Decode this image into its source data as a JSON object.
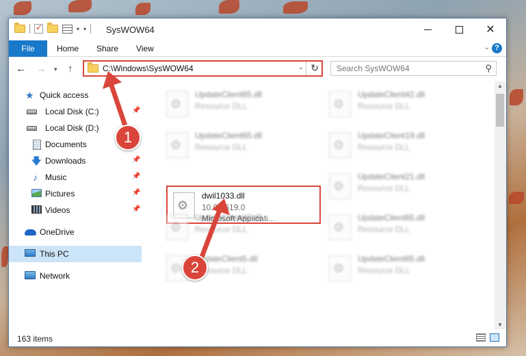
{
  "window": {
    "title": "SysWOW64",
    "controls": {
      "minimize": "—",
      "maximize": "□",
      "close": "✕"
    }
  },
  "ribbon": {
    "tabs": [
      "File",
      "Home",
      "Share",
      "View"
    ],
    "help": "?"
  },
  "navigation": {
    "back": "←",
    "forward": "→",
    "recent": "▾",
    "up": "↑",
    "address": "C:\\Windows\\SysWOW64",
    "refresh": "↻",
    "search_placeholder": "Search SysWOW64"
  },
  "sidebar": {
    "items": [
      {
        "label": "Quick access",
        "icon": "star-icon",
        "pinned": false
      },
      {
        "label": "Local Disk (C:)",
        "icon": "disk-icon",
        "pinned": true
      },
      {
        "label": "Local Disk (D:)",
        "icon": "disk-icon",
        "pinned": false
      },
      {
        "label": "Documents",
        "icon": "document-icon",
        "pinned": true
      },
      {
        "label": "Downloads",
        "icon": "download-icon",
        "pinned": true
      },
      {
        "label": "Music",
        "icon": "music-icon",
        "pinned": true
      },
      {
        "label": "Pictures",
        "icon": "picture-icon",
        "pinned": true
      },
      {
        "label": "Videos",
        "icon": "video-icon",
        "pinned": true
      },
      {
        "label": "OneDrive",
        "icon": "onedrive-icon",
        "pinned": false
      },
      {
        "label": "This PC",
        "icon": "pc-icon",
        "pinned": false,
        "selected": true
      },
      {
        "label": "Network",
        "icon": "network-icon",
        "pinned": false
      }
    ],
    "pin_glyph": "📌"
  },
  "files": [
    {
      "name": "UpdateClient65.dll",
      "line2": "Resource DLL",
      "line3": "",
      "blurred": true
    },
    {
      "name": "UpdateClient42.dll",
      "line2": "Resource DLL",
      "line3": "",
      "blurred": true
    },
    {
      "name": "UpdateClient65.dll",
      "line2": "Resource DLL",
      "line3": "",
      "blurred": true
    },
    {
      "name": "UpdateClient19.dll",
      "line2": "Resource DLL",
      "line3": "",
      "blurred": true
    },
    {
      "name": "dwil1033.dll",
      "line2": "10.0.2619.0",
      "line3": "Microsoft Applicati...",
      "blurred": false,
      "highlighted": true
    },
    {
      "name": "UpdateClient21.dll",
      "line2": "Resource DLL",
      "line3": "",
      "blurred": true
    },
    {
      "name": "UpdateClient42.dll",
      "line2": "Resource DLL",
      "line3": "",
      "blurred": true
    },
    {
      "name": "UpdateClient65.dll",
      "line2": "Resource DLL",
      "line3": "",
      "blurred": true
    },
    {
      "name": "UpdateClient5.dll",
      "line2": "Resource DLL",
      "line3": "",
      "blurred": true
    },
    {
      "name": "UpdateClient65.dll",
      "line2": "Resource DLL",
      "line3": "",
      "blurred": true
    }
  ],
  "status": {
    "item_count": "163 items"
  },
  "annotations": {
    "step1": "1",
    "step2": "2",
    "color": "#d9453a"
  }
}
